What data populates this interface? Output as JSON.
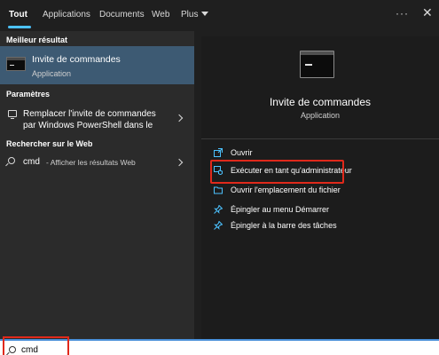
{
  "tabs": [
    {
      "label": "Tout",
      "active": true
    },
    {
      "label": "Applications"
    },
    {
      "label": "Documents"
    },
    {
      "label": "Web"
    },
    {
      "label": "Plus"
    }
  ],
  "top_icons": {
    "more": "more-icon",
    "close": "close-icon"
  },
  "left": {
    "best_result_heading": "Meilleur résultat",
    "best_result": {
      "title": "Invite de commandes",
      "subtitle": "Application",
      "icon": "command-prompt-icon"
    },
    "settings_heading": "Paramètres",
    "settings_item": {
      "line1": "Remplacer l'invite de commandes",
      "line2": "par Windows PowerShell dans le",
      "icon": "monitor-icon"
    },
    "web_heading": "Rechercher sur le Web",
    "web_item": {
      "query": "cmd",
      "hint": "- Afficher les résultats Web",
      "icon": "search-icon"
    }
  },
  "right": {
    "title": "Invite de commandes",
    "subtitle": "Application",
    "actions": [
      {
        "label": "Ouvrir",
        "icon": "open-icon"
      },
      {
        "label": "Exécuter en tant qu'administrateur",
        "icon": "run-as-admin-icon"
      },
      {
        "label": "Ouvrir l'emplacement du fichier",
        "icon": "folder-icon"
      },
      {
        "label": "Épingler au menu Démarrer",
        "icon": "pin-icon"
      },
      {
        "label": "Épingler à la barre des tâches",
        "icon": "pin-icon"
      }
    ]
  },
  "search": {
    "value": "cmd"
  },
  "colors": {
    "accent": "#4cc2ff",
    "highlight": "#e0291b",
    "selected": "#3d5a73"
  }
}
